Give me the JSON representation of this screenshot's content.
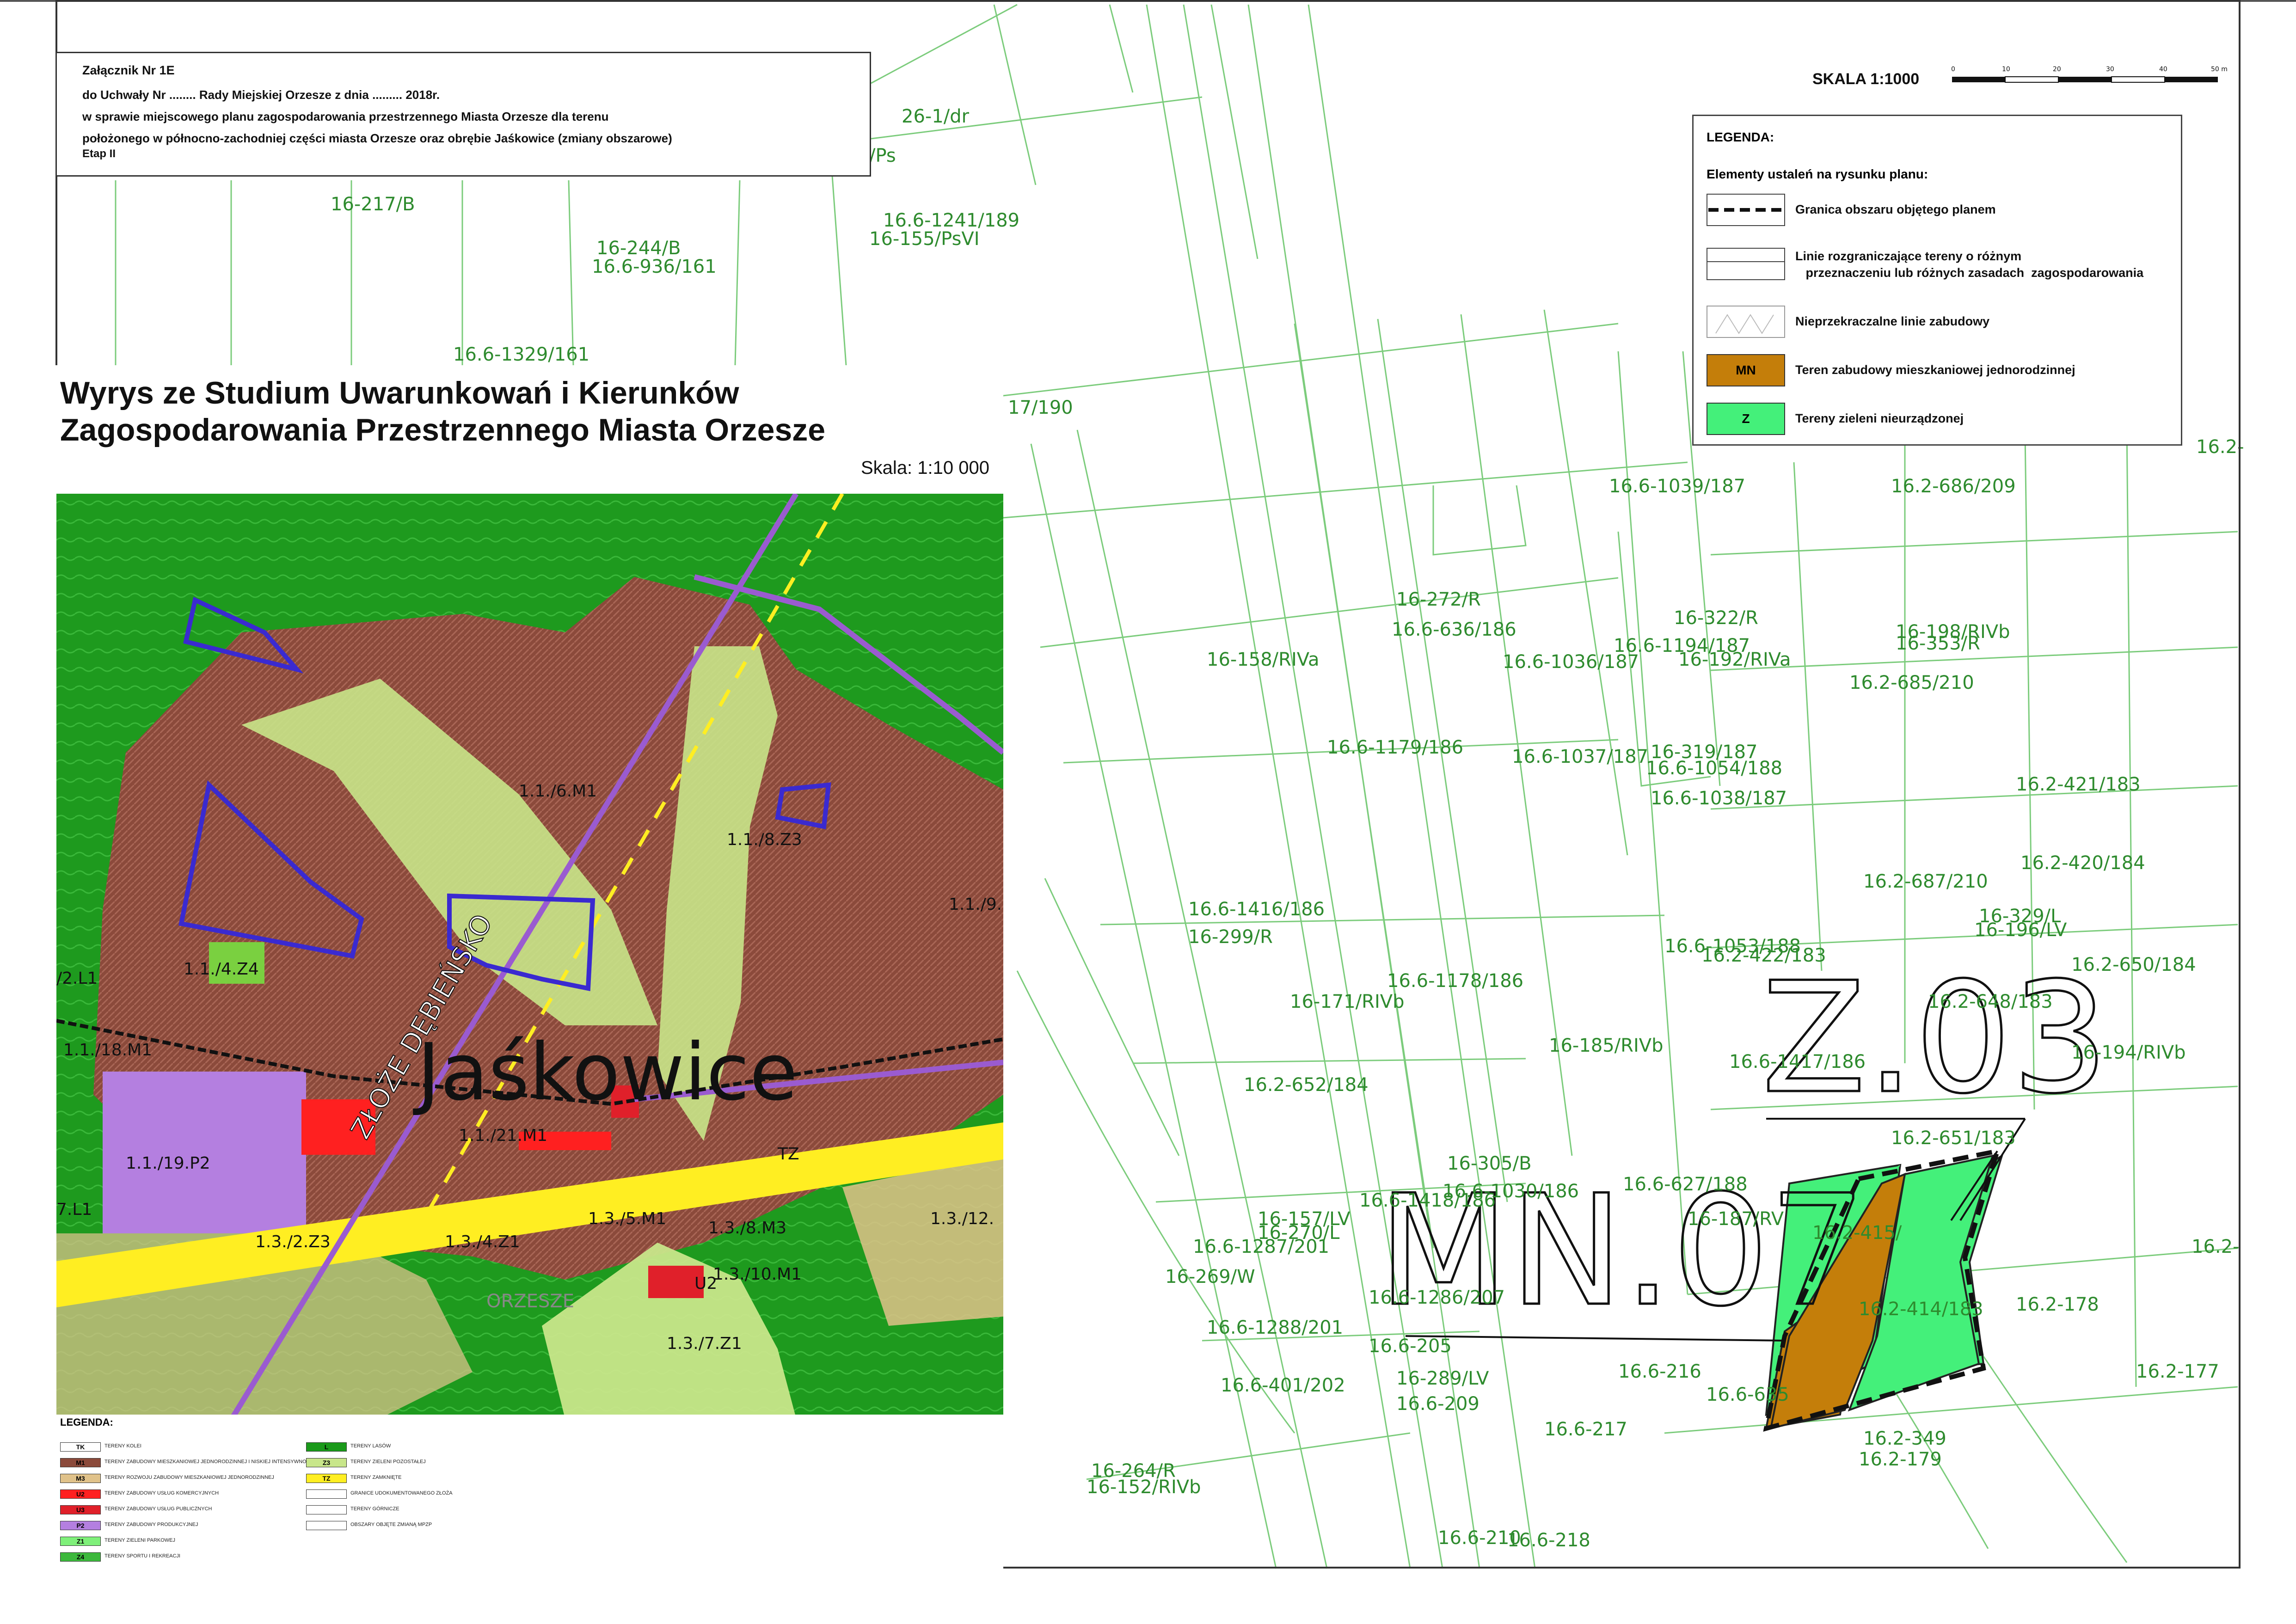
{
  "header": {
    "line1": "Załącznik Nr 1E",
    "line2": "do Uchwały Nr ........ Rady Miejskiej Orzesze  z dnia ......... 2018r.",
    "line3": "w sprawie miejscowego planu zagospodarowania  przestrzennego Miasta Orzesze dla terenu",
    "line4": "położonego w północno-zachodniej części miasta Orzesze oraz obrębie Jaśkowice (zmiany obszarowe)",
    "line5": "Etap II"
  },
  "scale": {
    "label": "SKALA 1:1000",
    "ticks": [
      "0",
      "10",
      "20",
      "30",
      "40",
      "50 m"
    ]
  },
  "legend": {
    "title": "LEGENDA:",
    "subtitle": "Elementy ustaleń na rysunku planu:",
    "items": [
      {
        "label": "Granica obszaru objętego planem"
      },
      {
        "label": "Linie rozgraniczające tereny o różnym\n   przeznaczeniu lub różnych zasadach  zagospodarowania"
      },
      {
        "label": "Nieprzekraczalne linie zabudowy"
      },
      {
        "symbol": "MN",
        "label": "Teren zabudowy mieszkaniowej jednorodzinnej",
        "color": "#c47e0a"
      },
      {
        "symbol": "Z",
        "label": "Tereny zieleni nieurządzonej",
        "color": "#44f07a"
      }
    ]
  },
  "plan_labels": {
    "mn": "MN.07",
    "z": "Z.03"
  },
  "studium": {
    "title_line1": "Wyrys ze Studium Uwarunkowań i Kierunków",
    "title_line2": "Zagospodarowania Przestrzennego Miasta Orzesze",
    "scale": "Skala: 1:10 000",
    "place": "Jaśkowice",
    "place2": "ORZESZE",
    "deposit": "ZŁOŻE DĘBIEŃSKO",
    "areas": [
      "1.1./6.M1",
      "1.1./8.Z3",
      "1.1./4.Z4",
      "1.1./18.M1",
      "1.1./19.P2",
      "1.1./21.M1",
      "1.3./5.M1",
      "1.3./8.M3",
      "1.3./2.Z3",
      "1.3./4.Z1",
      "1.3./10.M1",
      "1.3./7.Z1",
      "1.3./12.",
      "1.1./9.",
      "7.L1",
      "/2.L1",
      "TZ",
      "U2"
    ]
  },
  "small_legend": {
    "title": "LEGENDA:",
    "items": [
      {
        "code": "TK",
        "color": "#ffffff",
        "text": "TERENY KOLEI"
      },
      {
        "code": "M1",
        "color": "#8b4a3b",
        "text": "TERENY ZABUDOWY MIESZKANIOWEJ JEDNORODZINNEJ I NISKIEJ INTENSYWNOŚCI"
      },
      {
        "code": "M3",
        "color": "#e0c28a",
        "text": "TERENY ROZWOJU ZABUDOWY MIESZKANIOWEJ JEDNORODZINNEJ"
      },
      {
        "code": "U2",
        "color": "#ff2020",
        "text": "TERENY ZABUDOWY USŁUG KOMERCYJNYCH"
      },
      {
        "code": "U3",
        "color": "#e0202a",
        "text": "TERENY ZABUDOWY USŁUG PUBLICZNYCH"
      },
      {
        "code": "P2",
        "color": "#b47fe0",
        "text": "TERENY ZABUDOWY PRODUKCYJNEJ"
      },
      {
        "code": "Z1",
        "color": "#7ff07a",
        "text": "TERENY ZIELENI PARKOWEJ"
      },
      {
        "code": "Z4",
        "color": "#3cb83c",
        "text": "TERENY SPORTU I REKREACJI"
      },
      {
        "code": "L",
        "color": "#1a9a1a",
        "text": "TERENY LASÓW"
      },
      {
        "code": "Z3",
        "color": "#c8e68a",
        "text": "TERENY ZIELENI POZOSTAŁEJ"
      },
      {
        "code": "TZ",
        "color": "#ffee22",
        "text": "TERENY ZAMKNIĘTE"
      },
      {
        "code": "",
        "color": "#ffffff",
        "text": "GRANICE UDOKUMENTOWANEGO ZŁOŻA"
      },
      {
        "code": "",
        "color": "#ffffff",
        "text": "TERENY GÓRNICZE"
      },
      {
        "code": "",
        "color": "#ffffff",
        "text": "OBSZARY OBJĘTE ZMIANĄ MPZP"
      }
    ]
  },
  "parcels": [
    "16.6-1241/189",
    "16-155/PsVI",
    "16-244/B",
    "16.6-936/161",
    "16.6-1329/161",
    "17/190",
    "16.6-1039/187",
    "16.2-686/209",
    "16-272/R",
    "16.6-636/186",
    "16-322/R",
    "16-198/RIVb",
    "16-158/RIVa",
    "16.6-1194/187",
    "16-192/RIVa",
    "16-353/R",
    "16.6-1036/187",
    "16.2-685/210",
    "16.6-1179/186",
    "16.6-1037/187",
    "16-319/187",
    "16.6-1054/188",
    "16.6-1038/187",
    "16.2-421/183",
    "16.2-420/184",
    "16.6-1416/186",
    "16-299/R",
    "16.2-687/210",
    "16-329/L",
    "16-196/LV",
    "16.6-1053/188",
    "16.6-1178/186",
    "16.2-422/183",
    "16.2-650/184",
    "16-171/RIVb",
    "16.2-648/183",
    "16-185/RIVb",
    "16.6-1417/186",
    "16-194/RIVb",
    "16.2-652/184",
    "16.2-651/183",
    "16-305/B",
    "16.6-627/188",
    "16.6-1418/186",
    "16.6-1030/186",
    "16-157/LV",
    "16-270/L",
    "16-187/RV",
    "16.6-1287/201",
    "16-269/W",
    "16.6-1286/207",
    "16.2-415/",
    "16.2-414/183",
    "16.2-178",
    "16.6-1288/201",
    "16.6-205",
    "16-289/LV",
    "16.6-209",
    "16.6-216",
    "16.6-635",
    "16.2-177",
    "16.6-401/202",
    "16.6-217",
    "16.2-349",
    "16.2-179",
    "16-264/R",
    "16-152/RIVb",
    "16.6-210",
    "16.6-218",
    "16-217/B",
    "26-1/dr",
    "/Ps",
    "16.2-",
    "16.2-"
  ]
}
